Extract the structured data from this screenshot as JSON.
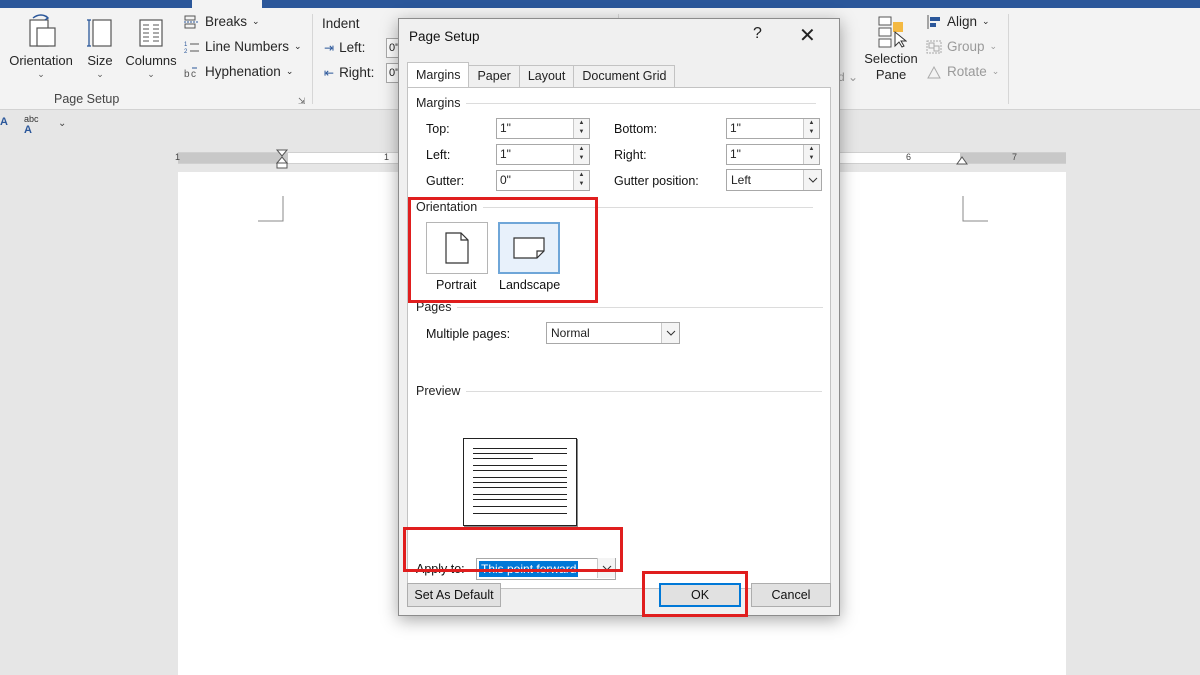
{
  "ribbon": {
    "orientation_label": "Orientation",
    "size_label": "Size",
    "columns_label": "Columns",
    "breaks_label": "Breaks",
    "line_numbers_label": "Line Numbers",
    "hyphenation_label": "Hyphenation",
    "page_setup_group": "Page Setup",
    "indent_title": "Indent",
    "indent_left_label": "Left:",
    "indent_right_label": "Right:",
    "indent_left_value": "0\"",
    "indent_right_value": "0\"",
    "selection_pane_line1": "Selection",
    "selection_pane_line2": "Pane",
    "align_label": "Align",
    "group_label": "Group",
    "rotate_label": "Rotate"
  },
  "ruler": {
    "num_left": "1",
    "num_one": "1",
    "num_six": "6",
    "num_seven": "7"
  },
  "dialog": {
    "title": "Page Setup",
    "help": "?",
    "close": "✕",
    "tabs": [
      {
        "label": "Margins"
      },
      {
        "label": "Paper"
      },
      {
        "label": "Layout"
      },
      {
        "label": "Document Grid"
      }
    ],
    "margins": {
      "section": "Margins",
      "top_label": "Top:",
      "top_value": "1\"",
      "bottom_label": "Bottom:",
      "bottom_value": "1\"",
      "left_label": "Left:",
      "left_value": "1\"",
      "right_label": "Right:",
      "right_value": "1\"",
      "gutter_label": "Gutter:",
      "gutter_value": "0\"",
      "gutter_position_label": "Gutter position:",
      "gutter_position_value": "Left"
    },
    "orientation": {
      "section": "Orientation",
      "portrait_label": "Portrait",
      "landscape_label": "Landscape"
    },
    "pages": {
      "section": "Pages",
      "multiple_label": "Multiple pages:",
      "multiple_value": "Normal"
    },
    "preview": {
      "section": "Preview"
    },
    "apply_to_label": "Apply to:",
    "apply_to_value": "This point forward",
    "set_default_label": "Set As Default",
    "ok_label": "OK",
    "cancel_label": "Cancel"
  },
  "colors": {
    "title_bar": "#2b579a",
    "highlight": "#e01e1e",
    "selection": "#0078d7"
  }
}
